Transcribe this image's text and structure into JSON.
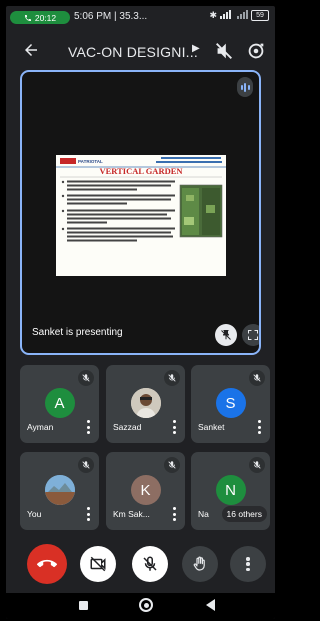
{
  "status_bar": {
    "call_time": "20:12",
    "clock": "5:06 PM | 35.3...",
    "battery": "59"
  },
  "header": {
    "title": "VAC-ON DESIGNI...",
    "back_icon": "arrow-back-icon",
    "actions": [
      "mute-speaker-icon",
      "switch-camera-icon"
    ]
  },
  "presentation": {
    "presenter_label": "Sanket is presenting",
    "slide": {
      "header_text": "PATRIOTAL",
      "title": "VERTICAL GARDEN"
    },
    "accent_color": "#8ab4f8"
  },
  "participants": [
    {
      "name": "Ayman",
      "initial": "A",
      "color": "#1e8e3e",
      "kind": "initial"
    },
    {
      "name": "Sazzad",
      "initial": "",
      "color": "#c8c8c8",
      "kind": "photo"
    },
    {
      "name": "Sanket",
      "initial": "S",
      "color": "#1a73e8",
      "kind": "initial"
    },
    {
      "name": "You",
      "initial": "",
      "color": "#5f8fb4",
      "kind": "photo"
    },
    {
      "name": "Km Sak...",
      "initial": "K",
      "color": "#8d6e63",
      "kind": "initial"
    },
    {
      "name": "Na",
      "initial": "N",
      "color": "#1e8e3e",
      "kind": "initial",
      "others_label": "16 others"
    }
  ],
  "controls": [
    "end-call-icon",
    "camera-off-icon",
    "mic-off-icon",
    "raise-hand-icon",
    "more-options-icon"
  ],
  "colors": {
    "end_call": "#d93025",
    "control_bg": "#3c4043",
    "white_control": "#ffffff"
  }
}
